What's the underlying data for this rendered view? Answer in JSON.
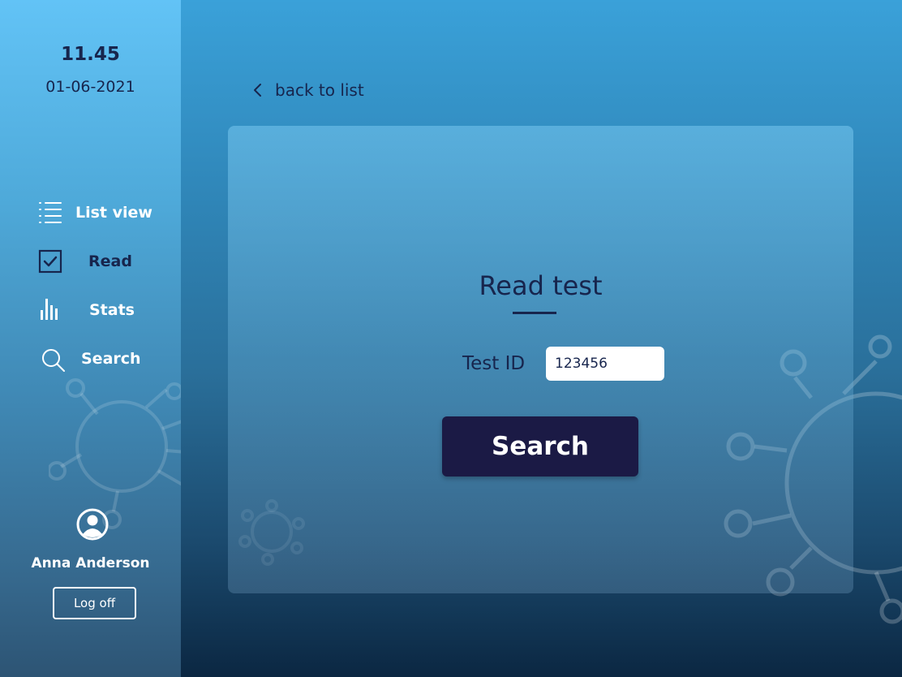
{
  "sidebar": {
    "time": "11.45",
    "date": "01-06-2021",
    "nav": [
      {
        "label": "List view",
        "icon": "list-icon"
      },
      {
        "label": "Read",
        "icon": "checkbox-icon"
      },
      {
        "label": "Stats",
        "icon": "bar-chart-icon"
      },
      {
        "label": "Search",
        "icon": "search-icon"
      }
    ],
    "user": {
      "name": "Anna Anderson",
      "avatar_icon": "user-avatar-icon"
    },
    "logoff_label": "Log off"
  },
  "main": {
    "back_label": "back to list",
    "title": "Read test",
    "test_id_label": "Test ID",
    "test_id_value": "123456",
    "search_button_label": "Search"
  },
  "colors": {
    "accent_dark": "#17254d",
    "button_bg": "#1b1a45",
    "text_light": "#ffffff"
  }
}
